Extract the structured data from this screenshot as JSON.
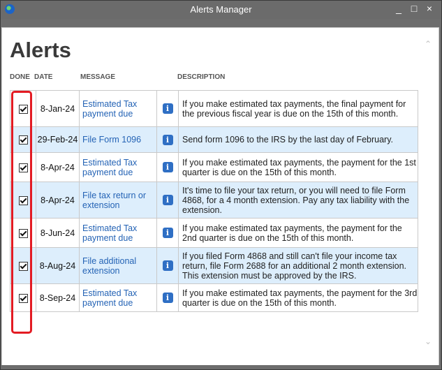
{
  "window": {
    "title": "Alerts Manager"
  },
  "heading": "Alerts",
  "columns": {
    "done": "DONE",
    "date": "DATE",
    "message": "MESSAGE",
    "description": "DESCRIPTION"
  },
  "rows": [
    {
      "done": true,
      "date": "8-Jan-24",
      "message": "Estimated Tax payment due",
      "description": "If you make estimated tax payments, the final payment for the previous fiscal year is due on the 15th of this month."
    },
    {
      "done": true,
      "date": "29-Feb-24",
      "message": "File Form 1096",
      "description": "Send form 1096 to the IRS by the last day of February."
    },
    {
      "done": true,
      "date": "8-Apr-24",
      "message": "Estimated Tax payment due",
      "description": "If you make estimated tax payments, the payment for the 1st quarter is due on the 15th of this month."
    },
    {
      "done": true,
      "date": "8-Apr-24",
      "message": "File tax return or extension",
      "description": "It's time to file your tax return, or you will need to file Form 4868, for a 4 month extension. Pay any tax liability with the extension."
    },
    {
      "done": true,
      "date": "8-Jun-24",
      "message": "Estimated Tax payment due",
      "description": "If you make estimated tax payments, the payment for the 2nd quarter is due on the 15th of this month."
    },
    {
      "done": true,
      "date": "8-Aug-24",
      "message": "File additional extension",
      "description": "If you filed Form 4868 and still can't file your income tax return, file Form 2688 for an additional 2 month extension. This extension must be approved by the IRS."
    },
    {
      "done": true,
      "date": "8-Sep-24",
      "message": "Estimated Tax payment due",
      "description": "If you make estimated tax payments, the payment for the 3rd quarter is due on the 15th of this month."
    }
  ],
  "icons": {
    "info": "i",
    "minimize": "_",
    "maximize": "□",
    "close": "×"
  },
  "colors": {
    "accent": "#2463b5",
    "highlight": "#e31b23",
    "alt_row": "#ddeefc"
  }
}
